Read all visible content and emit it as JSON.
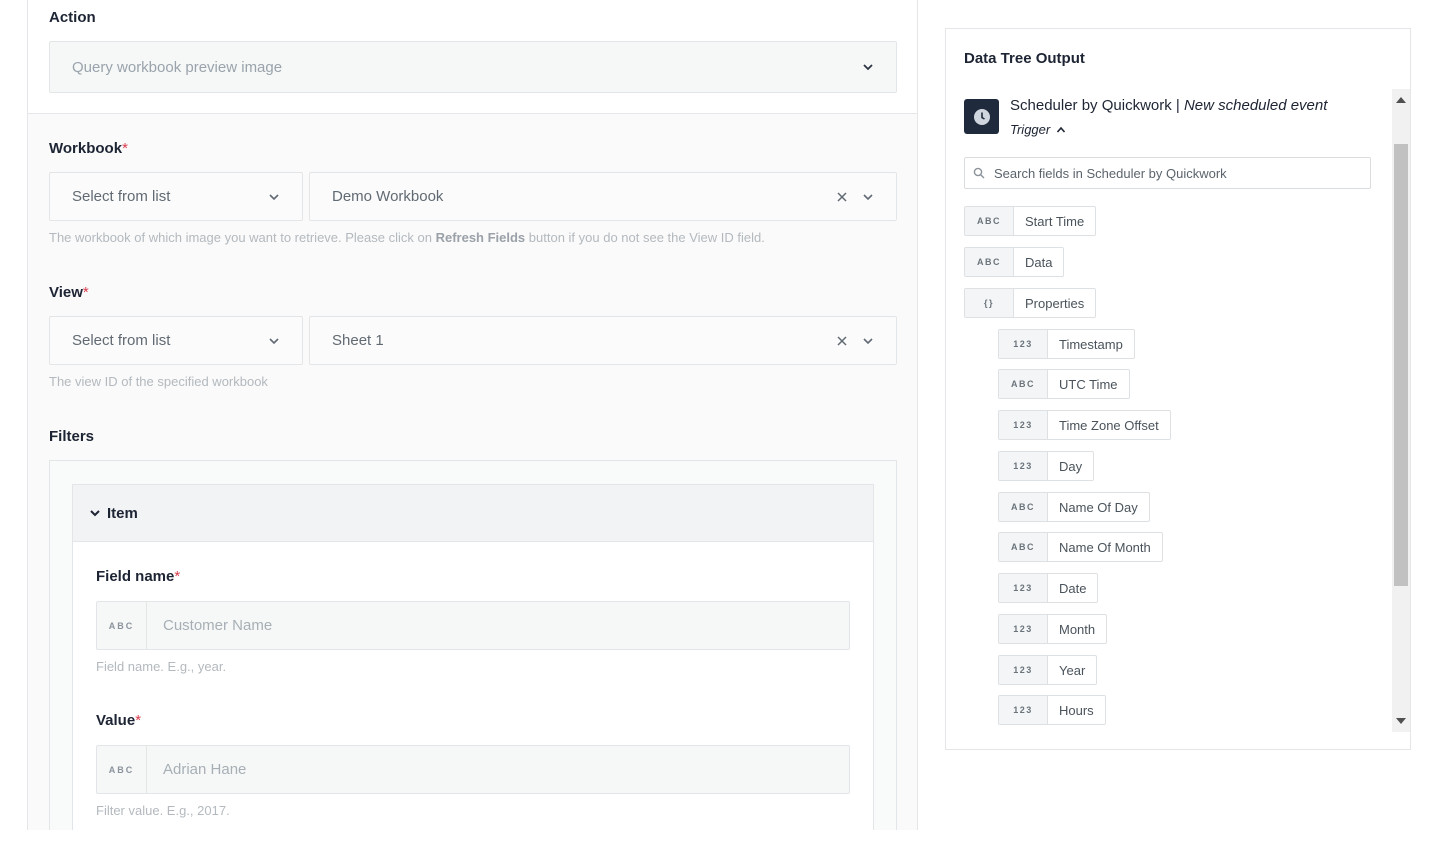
{
  "action": {
    "label": "Action",
    "value": "Query workbook preview image"
  },
  "workbook": {
    "label": "Workbook",
    "required_mark": "*",
    "mode": "Select from list",
    "value": "Demo Workbook",
    "help_prefix": "The workbook of which image you want to retrieve. Please click on ",
    "help_bold": "Refresh Fields",
    "help_suffix": " button if you do not see the View ID field."
  },
  "view": {
    "label": "View",
    "required_mark": "*",
    "mode": "Select from list",
    "value": "Sheet 1",
    "help": "The view ID of the specified workbook"
  },
  "filters": {
    "label": "Filters",
    "item_label": "Item",
    "field_name": {
      "label": "Field name",
      "required_mark": "*",
      "type": "ABC",
      "placeholder": "Customer Name",
      "help": "Field name. E.g., year."
    },
    "value": {
      "label": "Value",
      "required_mark": "*",
      "type": "ABC",
      "placeholder": "Adrian Hane",
      "help": "Filter value. E.g., 2017."
    }
  },
  "data_tree": {
    "title": "Data Tree Output",
    "app_name": "Scheduler by Quickwork",
    "separator": " | ",
    "event": "New scheduled event",
    "trigger_label": "Trigger",
    "search_placeholder": "Search fields in Scheduler by Quickwork",
    "fields": [
      {
        "type": "ABC",
        "label": "Start Time"
      },
      {
        "type": "ABC",
        "label": "Data"
      },
      {
        "type": "{}",
        "label": "Properties"
      },
      {
        "type": "123",
        "label": "Timestamp"
      },
      {
        "type": "ABC",
        "label": "UTC Time"
      },
      {
        "type": "123",
        "label": "Time Zone Offset"
      },
      {
        "type": "123",
        "label": "Day"
      },
      {
        "type": "ABC",
        "label": "Name Of Day"
      },
      {
        "type": "ABC",
        "label": "Name Of Month"
      },
      {
        "type": "123",
        "label": "Date"
      },
      {
        "type": "123",
        "label": "Month"
      },
      {
        "type": "123",
        "label": "Year"
      },
      {
        "type": "123",
        "label": "Hours"
      }
    ]
  },
  "colors": {
    "accent_dark": "#1f2b3d",
    "required": "#d93b4c"
  }
}
